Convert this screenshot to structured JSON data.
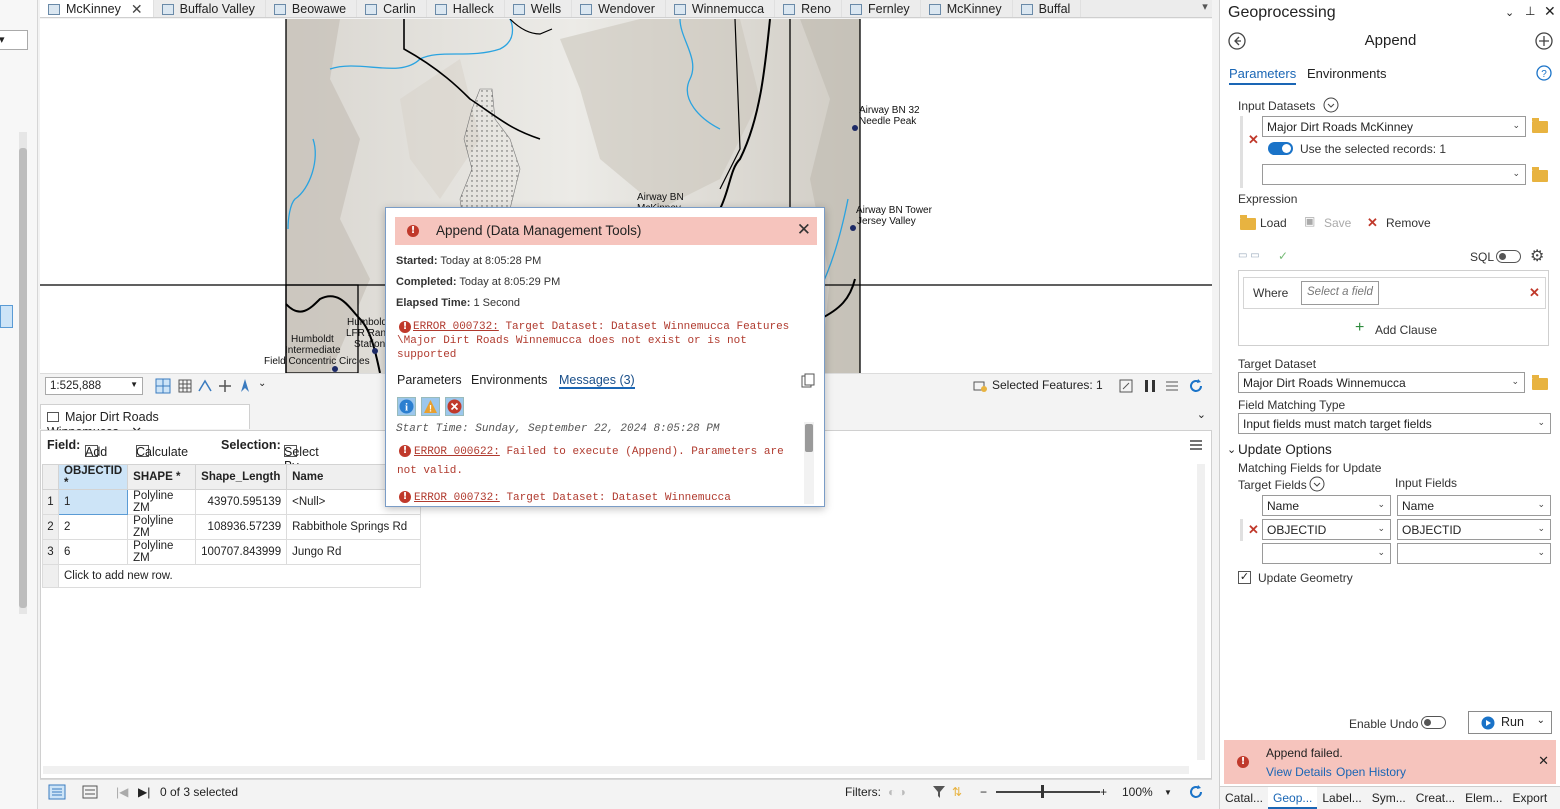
{
  "map_tabs": [
    {
      "label": "McKinney",
      "active": true
    },
    {
      "label": "Buffalo Valley"
    },
    {
      "label": "Beowawe"
    },
    {
      "label": "Carlin"
    },
    {
      "label": "Halleck"
    },
    {
      "label": "Wells"
    },
    {
      "label": "Wendover"
    },
    {
      "label": "Winnemucca"
    },
    {
      "label": "Reno"
    },
    {
      "label": "Fernley"
    },
    {
      "label": "McKinney"
    },
    {
      "label": "Buffal"
    }
  ],
  "map": {
    "labels": {
      "airway_32": "Airway BN 32",
      "needle_peak": "Needle Peak",
      "airway_mckinney_1": "Airway BN",
      "airway_mckinney_2": "McKinney",
      "airway_tower": "Airway BN Tower",
      "jersey_valley": "Jersey Valley",
      "humboldt_1": "Humboldt",
      "lfr": "LFR Ranch",
      "station": "Station",
      "humboldt_2": "Humboldt",
      "intermediate": "Intermediate",
      "field_circles": "Field Concentric Circles"
    },
    "scale": "1:525,888",
    "selected_features": "Selected Features: 1"
  },
  "popup": {
    "title": "Append (Data Management Tools)",
    "started_label": "Started:",
    "started_value": "Today at 8:05:28 PM",
    "completed_label": "Completed:",
    "completed_value": "Today at 8:05:29 PM",
    "elapsed_label": "Elapsed Time:",
    "elapsed_value": "1 Second",
    "error_code": "ERROR 000732:",
    "error_text_1": "Target Dataset: Dataset Winnemucca Features",
    "error_text_2": "\\Major Dirt Roads Winnemucca does not exist or is not",
    "error_text_3": "supported",
    "tabs": [
      "Parameters",
      "Environments",
      "Messages (3)"
    ],
    "start_time": "Start Time: Sunday, September 22, 2024 8:05:28 PM",
    "msg1_code": "ERROR 000622:",
    "msg1_text_1": "Failed to execute (Append). Parameters are",
    "msg1_text_2": "not valid.",
    "msg2_code": "ERROR 000732:",
    "msg2_text": "Target Dataset: Dataset Winnemucca"
  },
  "table": {
    "tab_label": "Major Dirt Roads Winnemucca",
    "toolbar": {
      "field": "Field:",
      "add": "Add",
      "calculate": "Calculate",
      "selection": "Selection:",
      "select_by_attr": "Select By Attribu"
    },
    "headers": [
      "OBJECTID *",
      "SHAPE *",
      "Shape_Length",
      "Name"
    ],
    "rows": [
      {
        "n": "1",
        "objectid": "1",
        "shape": "Polyline ZM",
        "length": "43970.595139",
        "name": "<Null>"
      },
      {
        "n": "2",
        "objectid": "2",
        "shape": "Polyline ZM",
        "length": "108936.57239",
        "name": "Rabbithole Springs Rd"
      },
      {
        "n": "3",
        "objectid": "6",
        "shape": "Polyline ZM",
        "length": "100707.843999",
        "name": "Jungo Rd"
      }
    ],
    "add_row": "Click to add new row.",
    "selection_status": "0 of 3 selected",
    "filters": "Filters:",
    "zoom": "100%"
  },
  "gp": {
    "title": "Geoprocessing",
    "tool": "Append",
    "tabs": [
      "Parameters",
      "Environments"
    ],
    "input_datasets_label": "Input Datasets",
    "input_dataset_value": "Major Dirt Roads McKinney",
    "use_selected": "Use the selected records: 1",
    "expression_label": "Expression",
    "load": "Load",
    "save": "Save",
    "remove": "Remove",
    "sql": "SQL",
    "where": "Where",
    "select_field": "Select a field",
    "add_clause": "Add Clause",
    "target_dataset_label": "Target Dataset",
    "target_dataset_value": "Major Dirt Roads Winnemucca",
    "field_matching_label": "Field Matching Type",
    "field_matching_value": "Input fields must match target fields",
    "update_options": "Update Options",
    "matching_fields": "Matching Fields for Update",
    "target_fields": "Target Fields",
    "input_fields": "Input Fields",
    "name_left": "Name",
    "name_right": "Name",
    "objectid_left": "OBJECTID",
    "objectid_right": "OBJECTID",
    "update_geometry": "Update Geometry",
    "enable_undo": "Enable Undo",
    "run": "Run",
    "fail_message": "Append failed.",
    "view_details": "View Details",
    "open_history": "Open History",
    "bottom_tabs": [
      "Catal...",
      "Geop...",
      "Label...",
      "Sym...",
      "Creat...",
      "Elem...",
      "Export"
    ]
  },
  "colors": {
    "accent": "#1a66b5",
    "error_bg": "#f6c4bd",
    "error_red": "#c0392b"
  }
}
